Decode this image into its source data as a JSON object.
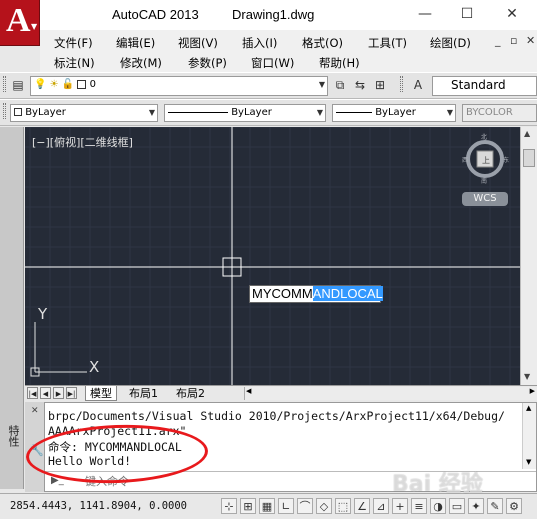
{
  "window": {
    "app_name": "AutoCAD 2013",
    "document": "Drawing1.dwg",
    "minimize": "—",
    "restore": "☐",
    "close": "✕"
  },
  "menus": {
    "row1": [
      "文件(F)",
      "编辑(E)",
      "视图(V)",
      "插入(I)",
      "格式(O)",
      "工具(T)",
      "绘图(D)"
    ],
    "row2": [
      "标注(N)",
      "修改(M)",
      "参数(P)",
      "窗口(W)",
      "帮助(H)"
    ],
    "mdi": [
      "_",
      "▫",
      "✕"
    ]
  },
  "layer_toolbar": {
    "layer_value": "0",
    "text_style": "Standard"
  },
  "properties_toolbar": {
    "color": "ByLayer",
    "linetype": "ByLayer",
    "lineweight": "ByLayer",
    "plotstyle": "BYCOLOR"
  },
  "side_palette": {
    "label": "特性"
  },
  "viewport": {
    "label": "[−][俯视][二维线框]",
    "ucs_x": "X",
    "ucs_y": "Y",
    "wcs": "WCS",
    "compass_n": "北",
    "compass_s": "南",
    "compass_e": "东",
    "compass_w": "西",
    "compass_top": "上"
  },
  "cmd_popup": {
    "typed": "MYCOMM",
    "selected": "ANDLOCAL"
  },
  "layout_tabs": [
    {
      "label": "模型",
      "active": true
    },
    {
      "label": "布局1",
      "active": false
    },
    {
      "label": "布局2",
      "active": false
    }
  ],
  "command_window": {
    "lines": [
      "brpc/Documents/Visual Studio 2010/Projects/ArxProject11/x64/Debug/",
      "AAAArxProject11.arx\"",
      "命令: MYCOMMANDLOCAL",
      "Hello World!"
    ],
    "input_placeholder": "键入命令"
  },
  "status": {
    "coordinates": "2854.4443, 1141.8904, 0.0000"
  },
  "watermark": "Bai 经验",
  "colors": {
    "canvas_bg": "#252b37",
    "grid_line": "#2f3644",
    "crosshair": "#ffffff",
    "annotation": "#e8191c",
    "selection": "#3399ff"
  }
}
